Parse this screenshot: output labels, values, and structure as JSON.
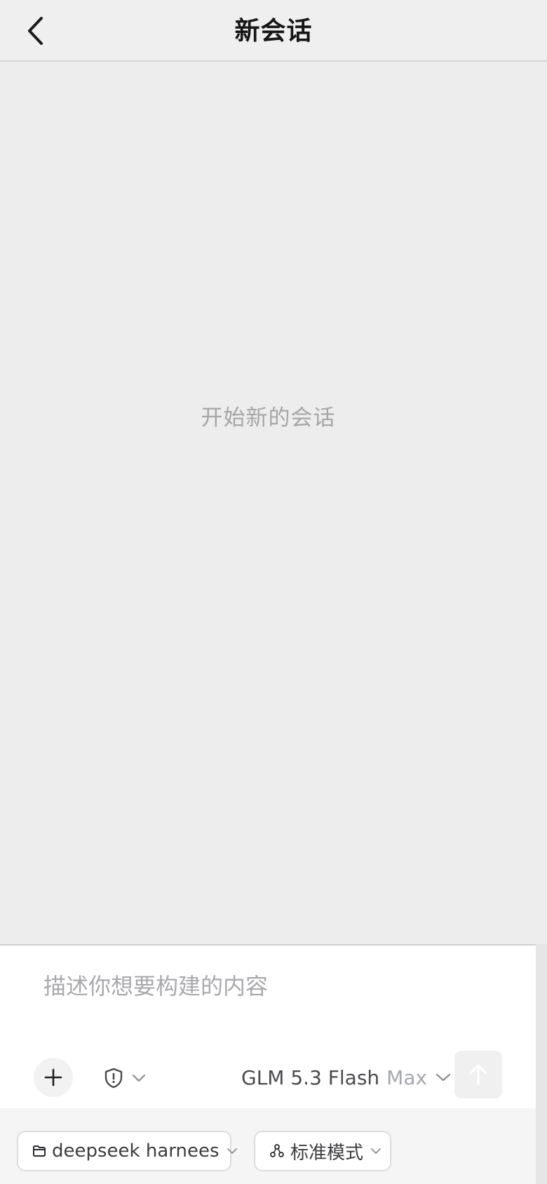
{
  "header": {
    "title": "新会话"
  },
  "main": {
    "empty_state_text": "开始新的会话"
  },
  "composer": {
    "placeholder": "描述你想要构建的内容",
    "value": "",
    "model": {
      "name": "GLM 5.3 Flash",
      "tier": "Max"
    }
  },
  "bottom_bar": {
    "workspace_label": "deepseek harnees",
    "mode_label": "标准模式"
  },
  "icons": {
    "back": "chevron-left-icon",
    "attach": "plus-icon",
    "safety": "shield-alert-icon",
    "send": "arrow-up-icon",
    "folder": "folder-icon",
    "mode": "nodes-icon"
  },
  "colors": {
    "background": "#ededed",
    "header_bg": "#efefef",
    "composer_bg": "#ffffff",
    "placeholder": "#a9a9ad",
    "muted_text": "#a6a6a6",
    "send_disabled_bg": "#f0f0f1"
  }
}
